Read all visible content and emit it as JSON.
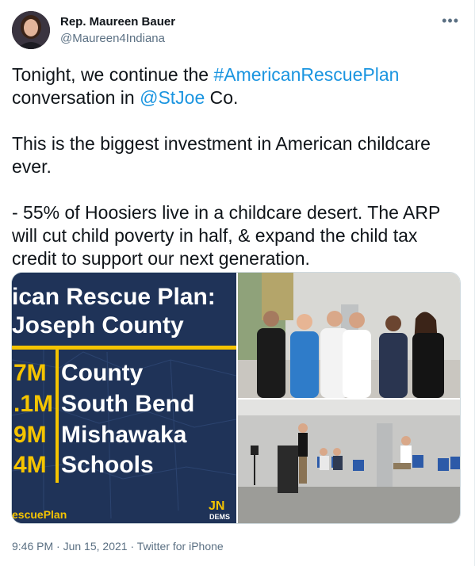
{
  "author": {
    "name": "Rep. Maureen Bauer",
    "handle": "@Maureen4Indiana"
  },
  "more_icon": "more-options-icon",
  "body": {
    "line1_pre": "Tonight, we continue the ",
    "hashtag": "#AmericanRescuePlan",
    "line2_pre": "conversation in ",
    "mention": "@StJoe",
    "line2_post": " Co.",
    "para2": "This is the biggest investment in American childcare ever.",
    "para3": "- 55% of Hoosiers live in a childcare desert. The ARP will cut child poverty in half, & expand the child tax credit to support our next generation."
  },
  "graphic": {
    "title1": "ican Rescue Plan:",
    "title2": "Joseph County",
    "rows": [
      {
        "amount": "7M",
        "label": "County"
      },
      {
        "amount": ".1M",
        "label": "South Bend"
      },
      {
        "amount": "9M",
        "label": "Mishawaka"
      },
      {
        "amount": "4M",
        "label": "Schools"
      }
    ],
    "footer": "escuePlan",
    "logo_top": "JN",
    "logo_bottom": "DEMS",
    "colors": {
      "background": "#1f3358",
      "accent": "#f5c400"
    }
  },
  "meta": {
    "time": "9:46 PM",
    "date": "Jun 15, 2021",
    "source": "Twitter for iPhone",
    "separator": "·"
  }
}
